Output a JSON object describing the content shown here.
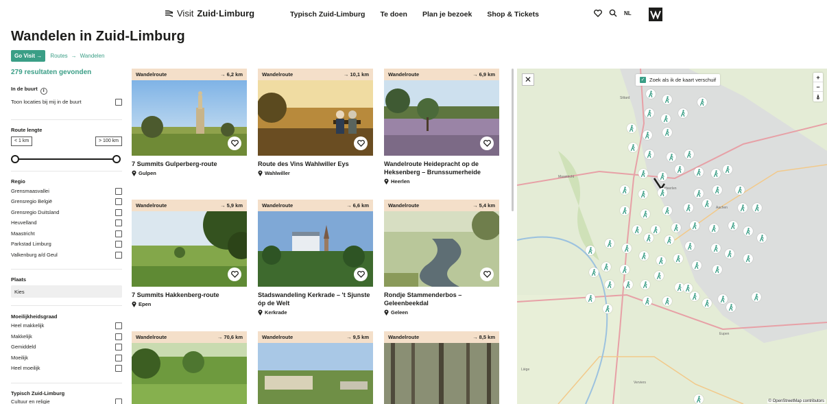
{
  "header": {
    "logo_visit": "Visit",
    "logo_region": "Zuid·Limburg",
    "nav": [
      "Typisch Zuid-Limburg",
      "Te doen",
      "Plan je bezoek",
      "Shop & Tickets"
    ],
    "language": "NL"
  },
  "page": {
    "title": "Wandelen in Zuid-Limburg",
    "breadcrumb": {
      "home": "Go Visit →",
      "routes": "Routes",
      "arrow": "→",
      "current": "Wandelen"
    }
  },
  "filters": {
    "results": "279 resultaten gevonden",
    "nearby": {
      "label": "In de buurt",
      "info_icon": "i",
      "option": "Toon locaties bij mij in de buurt"
    },
    "length": {
      "label": "Route lengte",
      "min": "< 1 km",
      "max": "> 100 km"
    },
    "region": {
      "label": "Regio",
      "options": [
        "Grensmaasvallei",
        "Grensregio België",
        "Grensregio Duitsland",
        "Heuvelland",
        "Maastricht",
        "Parkstad Limburg",
        "Valkenburg a/d Geul"
      ]
    },
    "place": {
      "label": "Plaats",
      "placeholder": "Kies"
    },
    "difficulty": {
      "label": "Moeilijkheidsgraad",
      "options": [
        "Heel makkelijk",
        "Makkelijk",
        "Gemiddeld",
        "Moeilijk",
        "Heel moeilijk"
      ]
    },
    "typical": {
      "label": "Typisch Zuid-Limburg",
      "options": [
        "Cultuur en religie"
      ]
    }
  },
  "cards": [
    {
      "type": "Wandelroute",
      "distance": "→ 6,2 km",
      "title": "7 Summits Gulperberg-route",
      "place": "Gulpen",
      "image": "statue-landscape"
    },
    {
      "type": "Wandelroute",
      "distance": "→ 10,1 km",
      "title": "Route des Vins Wahlwiller Eys",
      "place": "Wahlwiller",
      "image": "couple-bench-vineyard"
    },
    {
      "type": "Wandelroute",
      "distance": "→ 6,9 km",
      "title": "Wandelroute Heidepracht op de Heksenberg – Brunssumerheide",
      "place": "Heerlen",
      "image": "heath"
    },
    {
      "type": "Wandelroute",
      "distance": "→ 5,9 km",
      "title": "7 Summits Hakkenberg-route",
      "place": "Epen",
      "image": "meadow-trees"
    },
    {
      "type": "Wandelroute",
      "distance": "→ 6,6 km",
      "title": "Stadswandeling Kerkrade – 't Sjunste óp de Welt",
      "place": "Kerkrade",
      "image": "town-church"
    },
    {
      "type": "Wandelroute",
      "distance": "→ 5,4 km",
      "title": "Rondje Stammenderbos – Geleenbeekdal",
      "place": "Geleen",
      "image": "stream"
    },
    {
      "type": "Wandelroute",
      "distance": "→ 70,6 km",
      "title": "",
      "place": "",
      "image": "green-valley"
    },
    {
      "type": "Wandelroute",
      "distance": "→ 9,5 km",
      "title": "",
      "place": "",
      "image": "quarry"
    },
    {
      "type": "Wandelroute",
      "distance": "→ 8,5 km",
      "title": "",
      "place": "",
      "image": "forest"
    }
  ],
  "map": {
    "search_toggle": "Zoek als ik de kaart verschuif",
    "zoom_in": "+",
    "zoom_out": "−",
    "reset": "⍋",
    "attribution": "© OpenStreetMap contributors",
    "close": "✕",
    "labels": [
      "Aachen",
      "Maastricht",
      "Heerlen",
      "Sittard",
      "Liège",
      "Verviers",
      "Eupen"
    ]
  },
  "colors": {
    "accent": "#3a9e86",
    "card_bar": "#f4dfc9",
    "text": "#1d1d1b"
  }
}
